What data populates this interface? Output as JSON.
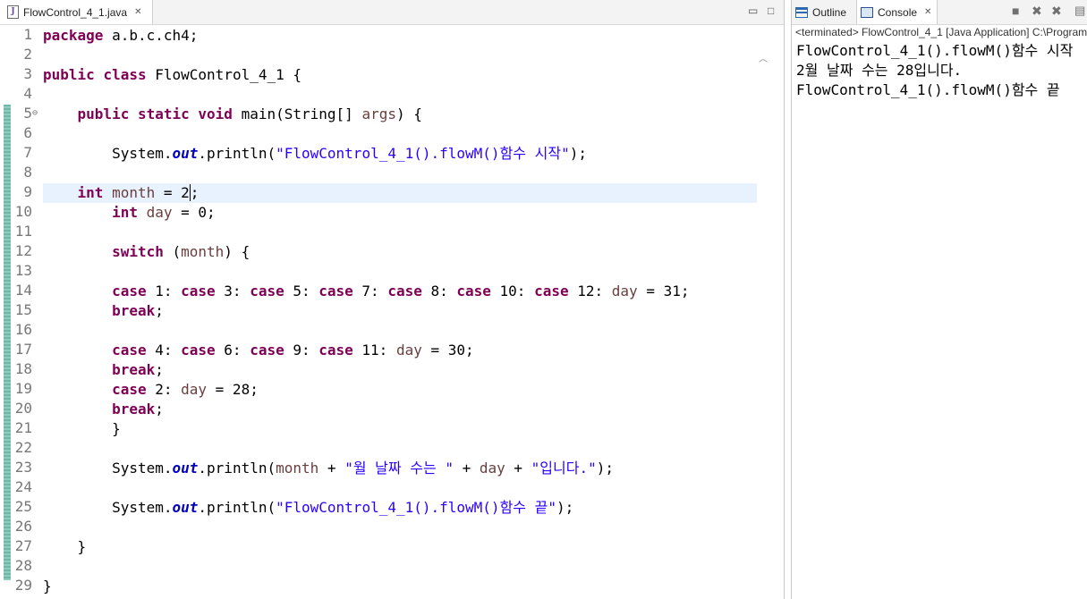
{
  "editor": {
    "tab_label": "FlowControl_4_1.java",
    "tab_icon": "java-file-icon",
    "lines": [
      {
        "n": "1",
        "tokens": [
          {
            "t": "package",
            "c": "kw"
          },
          {
            "t": " a.b.c.ch4;",
            "c": ""
          }
        ]
      },
      {
        "n": "2",
        "tokens": []
      },
      {
        "n": "3",
        "tokens": [
          {
            "t": "public",
            "c": "kw"
          },
          {
            "t": " ",
            "c": ""
          },
          {
            "t": "class",
            "c": "kw"
          },
          {
            "t": " FlowControl_4_1 {",
            "c": ""
          }
        ]
      },
      {
        "n": "4",
        "tokens": []
      },
      {
        "n": "5",
        "fold": "⊖",
        "tokens": [
          {
            "t": "    ",
            "c": ""
          },
          {
            "t": "public",
            "c": "kw"
          },
          {
            "t": " ",
            "c": ""
          },
          {
            "t": "static",
            "c": "kw"
          },
          {
            "t": " ",
            "c": ""
          },
          {
            "t": "void",
            "c": "kw"
          },
          {
            "t": " main(String[] ",
            "c": ""
          },
          {
            "t": "args",
            "c": "var"
          },
          {
            "t": ") {",
            "c": ""
          }
        ]
      },
      {
        "n": "6",
        "tokens": []
      },
      {
        "n": "7",
        "tokens": [
          {
            "t": "        System.",
            "c": ""
          },
          {
            "t": "out",
            "c": "field"
          },
          {
            "t": ".println(",
            "c": ""
          },
          {
            "t": "\"FlowControl_4_1().flowM()함수 시작\"",
            "c": "str"
          },
          {
            "t": ");",
            "c": ""
          }
        ]
      },
      {
        "n": "8",
        "tokens": []
      },
      {
        "n": "9",
        "current": true,
        "tokens": [
          {
            "t": "    ",
            "c": ""
          },
          {
            "t": "int",
            "c": "kw"
          },
          {
            "t": " ",
            "c": ""
          },
          {
            "t": "month",
            "c": "var"
          },
          {
            "t": " = 2",
            "c": ""
          },
          {
            "t": ";",
            "c": "caret"
          }
        ]
      },
      {
        "n": "10",
        "tokens": [
          {
            "t": "        ",
            "c": ""
          },
          {
            "t": "int",
            "c": "kw"
          },
          {
            "t": " ",
            "c": ""
          },
          {
            "t": "day",
            "c": "var"
          },
          {
            "t": " = 0;",
            "c": ""
          }
        ]
      },
      {
        "n": "11",
        "tokens": []
      },
      {
        "n": "12",
        "tokens": [
          {
            "t": "        ",
            "c": ""
          },
          {
            "t": "switch",
            "c": "kw"
          },
          {
            "t": " (",
            "c": ""
          },
          {
            "t": "month",
            "c": "var"
          },
          {
            "t": ") {",
            "c": ""
          }
        ]
      },
      {
        "n": "13",
        "tokens": []
      },
      {
        "n": "14",
        "tokens": [
          {
            "t": "        ",
            "c": ""
          },
          {
            "t": "case",
            "c": "kw"
          },
          {
            "t": " 1: ",
            "c": ""
          },
          {
            "t": "case",
            "c": "kw"
          },
          {
            "t": " 3: ",
            "c": ""
          },
          {
            "t": "case",
            "c": "kw"
          },
          {
            "t": " 5: ",
            "c": ""
          },
          {
            "t": "case",
            "c": "kw"
          },
          {
            "t": " 7: ",
            "c": ""
          },
          {
            "t": "case",
            "c": "kw"
          },
          {
            "t": " 8: ",
            "c": ""
          },
          {
            "t": "case",
            "c": "kw"
          },
          {
            "t": " 10: ",
            "c": ""
          },
          {
            "t": "case",
            "c": "kw"
          },
          {
            "t": " 12: ",
            "c": ""
          },
          {
            "t": "day",
            "c": "var"
          },
          {
            "t": " = 31;",
            "c": ""
          }
        ]
      },
      {
        "n": "15",
        "tokens": [
          {
            "t": "        ",
            "c": ""
          },
          {
            "t": "break",
            "c": "kw"
          },
          {
            "t": ";",
            "c": ""
          }
        ]
      },
      {
        "n": "16",
        "tokens": []
      },
      {
        "n": "17",
        "tokens": [
          {
            "t": "        ",
            "c": ""
          },
          {
            "t": "case",
            "c": "kw"
          },
          {
            "t": " 4: ",
            "c": ""
          },
          {
            "t": "case",
            "c": "kw"
          },
          {
            "t": " 6: ",
            "c": ""
          },
          {
            "t": "case",
            "c": "kw"
          },
          {
            "t": " 9: ",
            "c": ""
          },
          {
            "t": "case",
            "c": "kw"
          },
          {
            "t": " 11: ",
            "c": ""
          },
          {
            "t": "day",
            "c": "var"
          },
          {
            "t": " = 30;",
            "c": ""
          }
        ]
      },
      {
        "n": "18",
        "tokens": [
          {
            "t": "        ",
            "c": ""
          },
          {
            "t": "break",
            "c": "kw"
          },
          {
            "t": ";",
            "c": ""
          }
        ]
      },
      {
        "n": "19",
        "tokens": [
          {
            "t": "        ",
            "c": ""
          },
          {
            "t": "case",
            "c": "kw"
          },
          {
            "t": " 2: ",
            "c": ""
          },
          {
            "t": "day",
            "c": "var"
          },
          {
            "t": " = 28;",
            "c": ""
          }
        ]
      },
      {
        "n": "20",
        "tokens": [
          {
            "t": "        ",
            "c": ""
          },
          {
            "t": "break",
            "c": "kw"
          },
          {
            "t": ";",
            "c": ""
          }
        ]
      },
      {
        "n": "21",
        "tokens": [
          {
            "t": "        }",
            "c": ""
          }
        ]
      },
      {
        "n": "22",
        "tokens": []
      },
      {
        "n": "23",
        "tokens": [
          {
            "t": "        System.",
            "c": ""
          },
          {
            "t": "out",
            "c": "field"
          },
          {
            "t": ".println(",
            "c": ""
          },
          {
            "t": "month",
            "c": "var"
          },
          {
            "t": " + ",
            "c": ""
          },
          {
            "t": "\"월 날짜 수는 \"",
            "c": "str"
          },
          {
            "t": " + ",
            "c": ""
          },
          {
            "t": "day",
            "c": "var"
          },
          {
            "t": " + ",
            "c": ""
          },
          {
            "t": "\"입니다.\"",
            "c": "str"
          },
          {
            "t": ");",
            "c": ""
          }
        ]
      },
      {
        "n": "24",
        "tokens": []
      },
      {
        "n": "25",
        "tokens": [
          {
            "t": "        System.",
            "c": ""
          },
          {
            "t": "out",
            "c": "field"
          },
          {
            "t": ".println(",
            "c": ""
          },
          {
            "t": "\"FlowControl_4_1().flowM()함수 끝\"",
            "c": "str"
          },
          {
            "t": ");",
            "c": ""
          }
        ]
      },
      {
        "n": "26",
        "tokens": []
      },
      {
        "n": "27",
        "tokens": [
          {
            "t": "    }",
            "c": ""
          }
        ]
      },
      {
        "n": "28",
        "tokens": []
      },
      {
        "n": "29",
        "tokens": [
          {
            "t": "}",
            "c": ""
          }
        ]
      }
    ]
  },
  "side_panel": {
    "outline_tab_label": "Outline",
    "console_tab_label": "Console",
    "status": "<terminated> FlowControl_4_1 [Java Application] C:\\Program",
    "output_lines": [
      "FlowControl_4_1().flowM()함수 시작",
      "2월 날짜 수는 28입니다.",
      "FlowControl_4_1().flowM()함수 끝"
    ]
  },
  "colors": {
    "keyword": "#7f0055",
    "string": "#2a00ff",
    "static_field": "#0000c0",
    "local_var": "#6a3e3e",
    "current_line": "#e8f2fe"
  }
}
